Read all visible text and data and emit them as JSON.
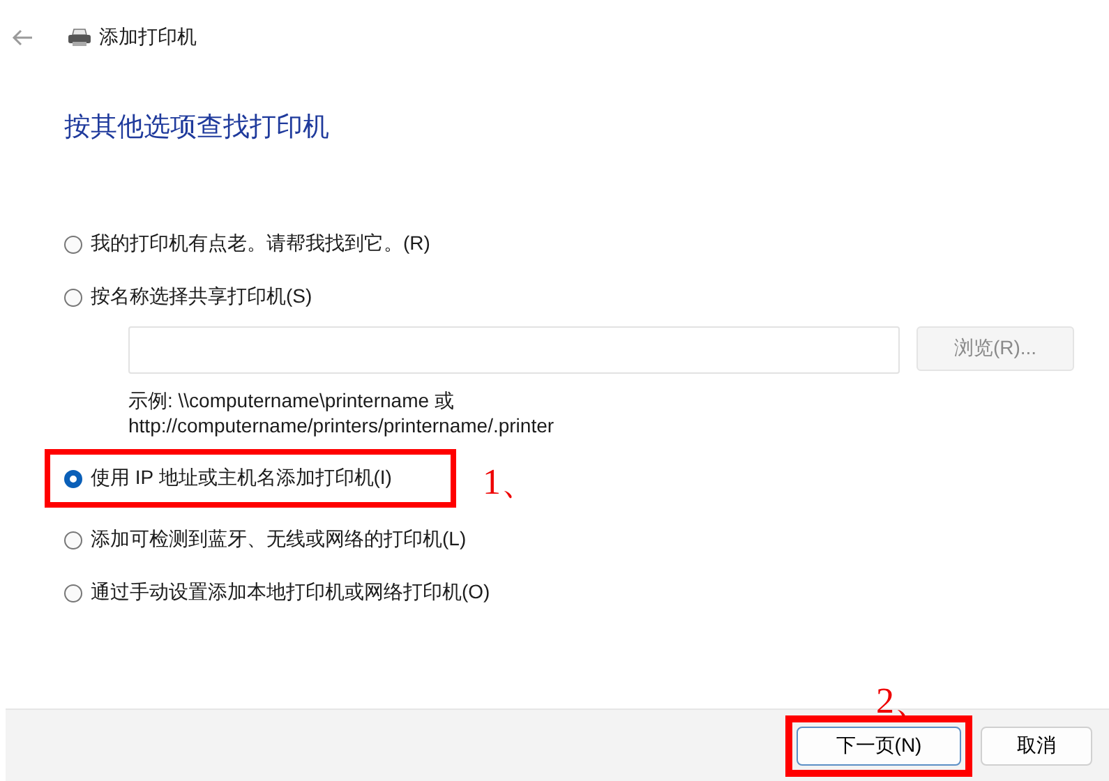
{
  "window": {
    "title": "添加打印机"
  },
  "heading": "按其他选项查找打印机",
  "options": [
    {
      "label": "我的打印机有点老。请帮我找到它。(R)",
      "selected": false
    },
    {
      "label": "按名称选择共享打印机(S)",
      "selected": false,
      "share_field": {
        "browse_button": "浏览(R)...",
        "browse_disabled": true,
        "example": [
          "示例: \\\\computername\\printername 或",
          "http://computername/printers/printername/.printer"
        ]
      }
    },
    {
      "label": "使用 IP 地址或主机名添加打印机(I)",
      "selected": true,
      "annotation": "1、"
    },
    {
      "label": "添加可检测到蓝牙、无线或网络的打印机(L)",
      "selected": false
    },
    {
      "label": "通过手动设置添加本地打印机或网络打印机(O)",
      "selected": false
    }
  ],
  "buttons": [
    {
      "label": "下一页(N)",
      "default": true,
      "annotation": "2、"
    },
    {
      "label": "取消",
      "default": false
    }
  ]
}
